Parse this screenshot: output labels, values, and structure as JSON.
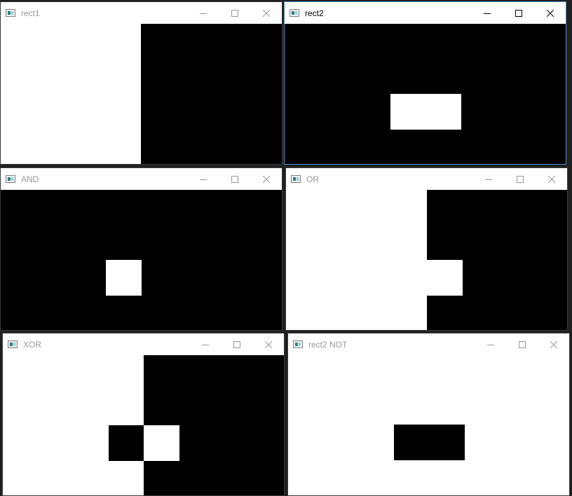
{
  "windows": [
    {
      "title": "rect1",
      "active": false
    },
    {
      "title": "rect2",
      "active": true
    },
    {
      "title": "AND",
      "active": false
    },
    {
      "title": "OR",
      "active": false
    },
    {
      "title": "XOR",
      "active": false
    },
    {
      "title": "rect2 NOT",
      "active": false
    }
  ],
  "colors": {
    "inactive_title": "#999999",
    "active_title": "#000000",
    "active_border": "#4a90c8",
    "desktop": "#202020"
  },
  "icons": [
    "app-icon",
    "minimize-icon",
    "maximize-icon",
    "close-icon"
  ]
}
